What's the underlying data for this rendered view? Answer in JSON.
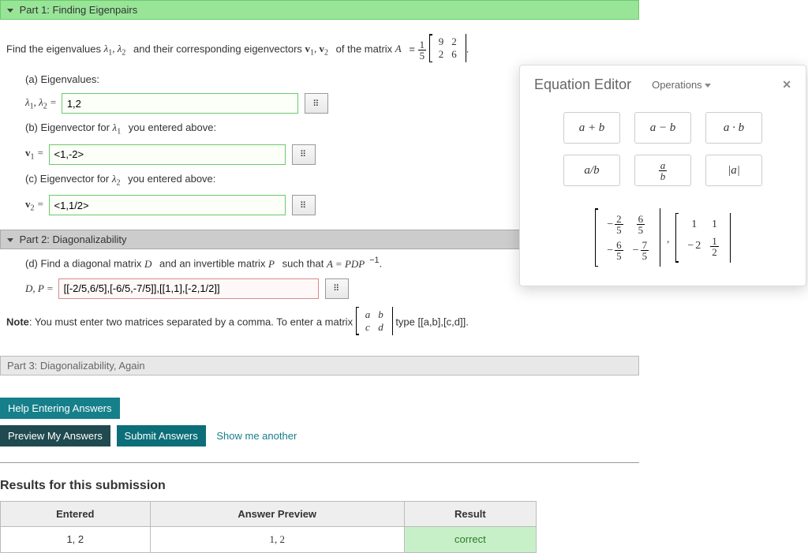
{
  "part1": {
    "title": "Part 1: Finding Eigenpairs",
    "prompt_prefix": "Find the eigenvalues ",
    "prompt_mid": " and their corresponding eigenvectors ",
    "prompt_suffix": " of the matrix ",
    "A_label": "A",
    "A_scalar_num": "1",
    "A_scalar_den": "5",
    "A_matrix": [
      [
        "9",
        "2"
      ],
      [
        "2",
        "6"
      ]
    ],
    "a_label": "(a) Eigenvalues:",
    "a_lhs": "λ₁, λ₂ =",
    "a_value": "1,2",
    "b_label": "(b) Eigenvector for λ₁ you entered above:",
    "b_lhs": "v₁ =",
    "b_value": "<1,-2>",
    "c_label": "(c) Eigenvector for λ₂ you entered above:",
    "c_lhs": "v₂ =",
    "c_value": "<1,1/2>"
  },
  "part2": {
    "title": "Part 2: Diagonalizability",
    "d_label": "(d) Find a diagonal matrix D and an invertible matrix P such that A = PDP⁻¹.",
    "d_lhs": "D, P =",
    "d_value": "[[-2/5,6/5],[-6/5,-7/5]],[[1,1],[-2,1/2]]",
    "note_prefix": "Note",
    "note_text1": ": You must enter two matrices separated by a comma. To enter a matrix ",
    "note_matrix": [
      [
        "a",
        "b"
      ],
      [
        "c",
        "d"
      ]
    ],
    "note_text2": " type [[a,b],[c,d]]."
  },
  "part3": {
    "title": "Part 3: Diagonalizability, Again"
  },
  "buttons": {
    "help": "Help Entering Answers",
    "preview": "Preview My Answers",
    "submit": "Submit Answers",
    "another": "Show me another"
  },
  "results": {
    "heading": "Results for this submission",
    "headers": [
      "Entered",
      "Answer Preview",
      "Result"
    ],
    "row1": [
      "1, 2",
      "1, 2",
      "correct"
    ]
  },
  "eq": {
    "title": "Equation Editor",
    "ops": "Operations",
    "btns_row1": [
      "a + b",
      "a − b",
      "a · b"
    ],
    "btns_row2": [
      "a/b",
      "frac",
      "|a|"
    ],
    "matrix_left": [
      [
        "−2/5",
        "6/5"
      ],
      [
        "−6/5",
        "−7/5"
      ]
    ],
    "matrix_right": [
      [
        "1",
        "1"
      ],
      [
        "−2",
        "1/2"
      ]
    ]
  },
  "math_btn_glyph": "⠿"
}
